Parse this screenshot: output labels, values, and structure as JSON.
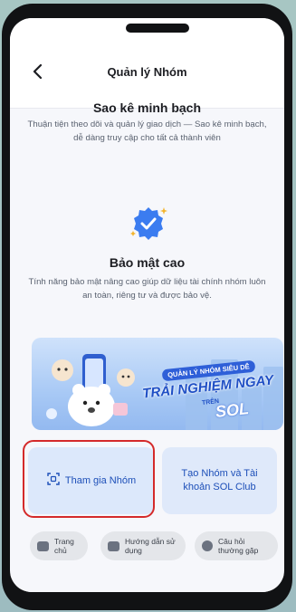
{
  "header": {
    "title": "Quản lý Nhóm",
    "back_icon": "chevron-left-icon"
  },
  "section_statement": {
    "title": "Sao kê minh bạch",
    "description": "Thuận tiện theo dõi và quản lý giao dịch — Sao kê minh bạch, dễ dàng truy cập cho tất cả thành viên"
  },
  "section_security": {
    "badge_icon": "verified-shield-icon",
    "title": "Bảo mật cao",
    "description": "Tính năng bảo mật nâng cao giúp dữ liệu tài chính nhóm luôn an toàn, riêng tư và được bảo vệ."
  },
  "banner": {
    "line1": "QUẢN LÝ NHÓM SIÊU DỄ",
    "line2": "TRẢI NGHIỆM NGAY",
    "line3": "TRÊN",
    "line4": "SOL"
  },
  "actions": {
    "join_label": "Tham gia Nhóm",
    "join_icon": "qr-scan-icon",
    "create_label": "Tạo Nhóm và Tài khoản SOL Club"
  },
  "shortcuts": [
    {
      "label": "Trang chủ",
      "icon": "home-icon"
    },
    {
      "label": "Hướng dẫn sử dụng",
      "icon": "guide-book-icon"
    },
    {
      "label": "Câu hỏi thường gặp",
      "icon": "info-icon"
    }
  ],
  "colors": {
    "accent": "#1d4fb8",
    "highlight": "#d42a2a",
    "card_bg": "#dce8fb"
  }
}
